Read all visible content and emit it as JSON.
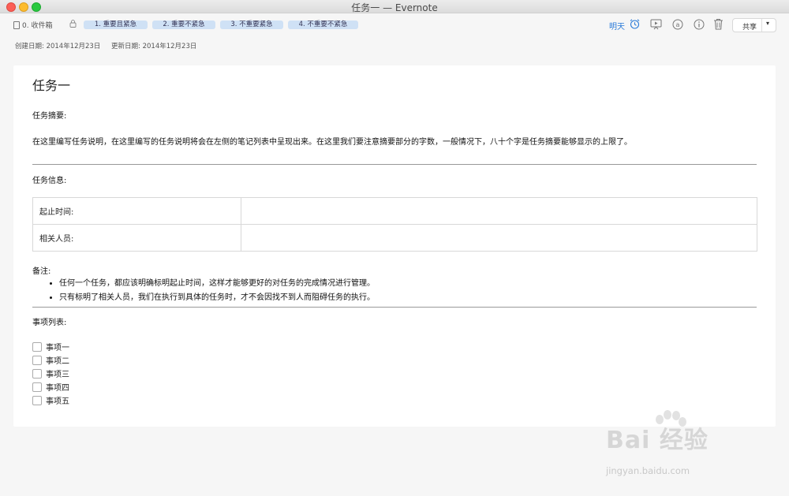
{
  "window": {
    "title": "任务一 — Evernote"
  },
  "toolbar": {
    "notebook": "0. 收件箱",
    "tags": [
      "1. 重要且紧急",
      "2. 重要不紧急",
      "3. 不重要紧急",
      "4. 不重要不紧急"
    ],
    "tomorrow": "明天",
    "share": "共享"
  },
  "meta": {
    "created": "创建日期: 2014年12月23日",
    "updated": "更新日期: 2014年12月23日"
  },
  "note": {
    "title": "任务一",
    "summary_heading": "任务摘要:",
    "summary_text": "在这里编写任务说明，在这里编写的任务说明将会在左侧的笔记列表中呈现出来。在这里我们要注意摘要部分的字数，一般情况下，八十个字是任务摘要能够显示的上限了。",
    "info_heading": "任务信息:",
    "info_rows": [
      {
        "label": "起止时间:",
        "value": ""
      },
      {
        "label": "相关人员:",
        "value": ""
      }
    ],
    "remarks_heading": "备注:",
    "remarks": [
      "任何一个任务，都应该明确标明起止时间，这样才能够更好的对任务的完成情况进行管理。",
      "只有标明了相关人员，我们在执行到具体的任务时，才不会因找不到人而阻碍任务的执行。"
    ],
    "list_heading": "事项列表:",
    "items": [
      "事项一",
      "事项二",
      "事项三",
      "事项四",
      "事项五"
    ]
  },
  "watermark": {
    "brand": "Bai 经验",
    "url": "jingyan.baidu.com"
  }
}
